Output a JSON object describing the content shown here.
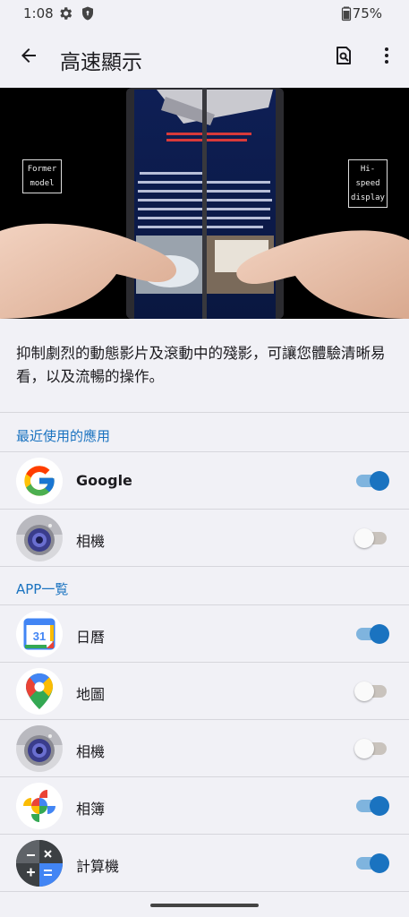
{
  "status_bar": {
    "time": "1:08",
    "battery": "75%"
  },
  "header": {
    "title": "高速顯示"
  },
  "hero": {
    "former_label": "Former model",
    "hispeed_label": "Hi-speed display",
    "screen_text_top": "タッチされた場所を精度高く認識で、スムーズなタッチ操作が可能となります",
    "screen_text_body": "■風呂場、濡れた手でも大丈夫 お水スマなのに、画面が濡れると誤動作したり、うまく操作できなかった経験ありませんか？スマートフォンAQUOSでは、タッチパネルの感度調整を徹底的に最適化することで、自動的に反応ちょきを感じる操作感覚はもちろん、画面が水に濡れても快適な操作性を実現しています"
  },
  "description": "抑制劇烈的動態影片及滾動中的殘影，可讓您體驗清晰易看，以及流暢的操作。",
  "sections": {
    "recent": {
      "title": "最近使用的應用",
      "apps": [
        {
          "name": "Google",
          "icon": "google-icon",
          "enabled": true
        },
        {
          "name": "相機",
          "icon": "camera-icon",
          "enabled": false
        }
      ]
    },
    "all": {
      "title": "APP一覧",
      "apps": [
        {
          "name": "日曆",
          "icon": "calendar-icon",
          "icon_text": "31",
          "enabled": true
        },
        {
          "name": "地圖",
          "icon": "maps-icon",
          "enabled": false
        },
        {
          "name": "相機",
          "icon": "camera-icon",
          "enabled": false
        },
        {
          "name": "相簿",
          "icon": "photos-icon",
          "enabled": true
        },
        {
          "name": "計算機",
          "icon": "calculator-icon",
          "enabled": true
        }
      ]
    }
  },
  "colors": {
    "accent": "#1a73c0",
    "toggle_on_track": "#7fb4de",
    "toggle_off_track": "#c9c3bd"
  }
}
